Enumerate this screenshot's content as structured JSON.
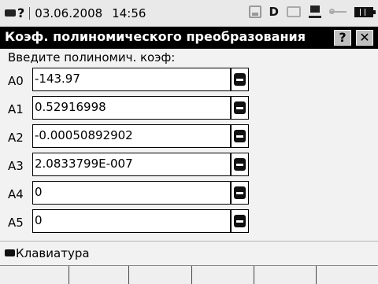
{
  "status_bar": {
    "help_symbol": "?",
    "date": "03.06.2008",
    "time": "14:56",
    "drive_letter": "D",
    "icons": [
      "keyboard-icon",
      "disk-icon",
      "printer-icon",
      "network-icon",
      "usb-icon",
      "battery-icon"
    ]
  },
  "title_bar": {
    "title": "Коэф. полиномического преобразования",
    "help_label": "?",
    "close_label": "✕"
  },
  "prompt": "Введите полиномич. коэф:",
  "coefficients": [
    {
      "label": "A0",
      "value": "-143.97"
    },
    {
      "label": "A1",
      "value": "0.52916998"
    },
    {
      "label": "A2",
      "value": "-0.00050892902"
    },
    {
      "label": "A3",
      "value": "2.0833799E-007"
    },
    {
      "label": "A4",
      "value": "0"
    },
    {
      "label": "A5",
      "value": "0"
    }
  ],
  "keyboard_bar": {
    "label": "Клавиатура"
  }
}
